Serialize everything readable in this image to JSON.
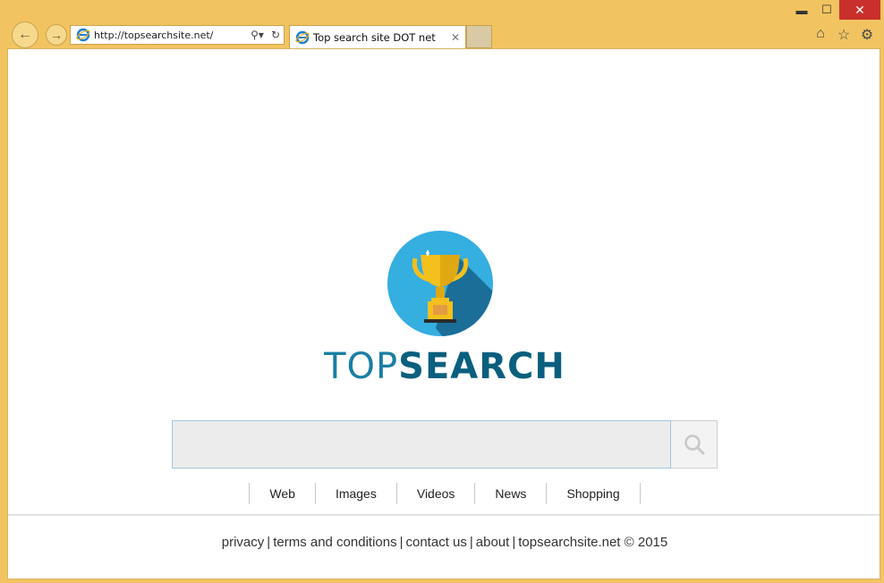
{
  "browser": {
    "url": "http://topsearchsite.net/",
    "tab_title": "Top search site DOT net",
    "minimize_label": "▬",
    "maximize_label": "☐",
    "close_label": "✕"
  },
  "logo": {
    "brand_light": "TOP",
    "brand_bold": "SEARCH",
    "circle_color": "#35aee0",
    "shadow_color": "#1c6f96",
    "trophy_color": "#f3c01d"
  },
  "search": {
    "value": "",
    "placeholder": ""
  },
  "search_tabs": [
    {
      "label": "Web"
    },
    {
      "label": "Images"
    },
    {
      "label": "Videos"
    },
    {
      "label": "News"
    },
    {
      "label": "Shopping"
    }
  ],
  "footer": {
    "privacy": "privacy",
    "terms": "terms and conditions",
    "contact": "contact us",
    "about": "about",
    "copyright": "topsearchsite.net © 2015"
  }
}
